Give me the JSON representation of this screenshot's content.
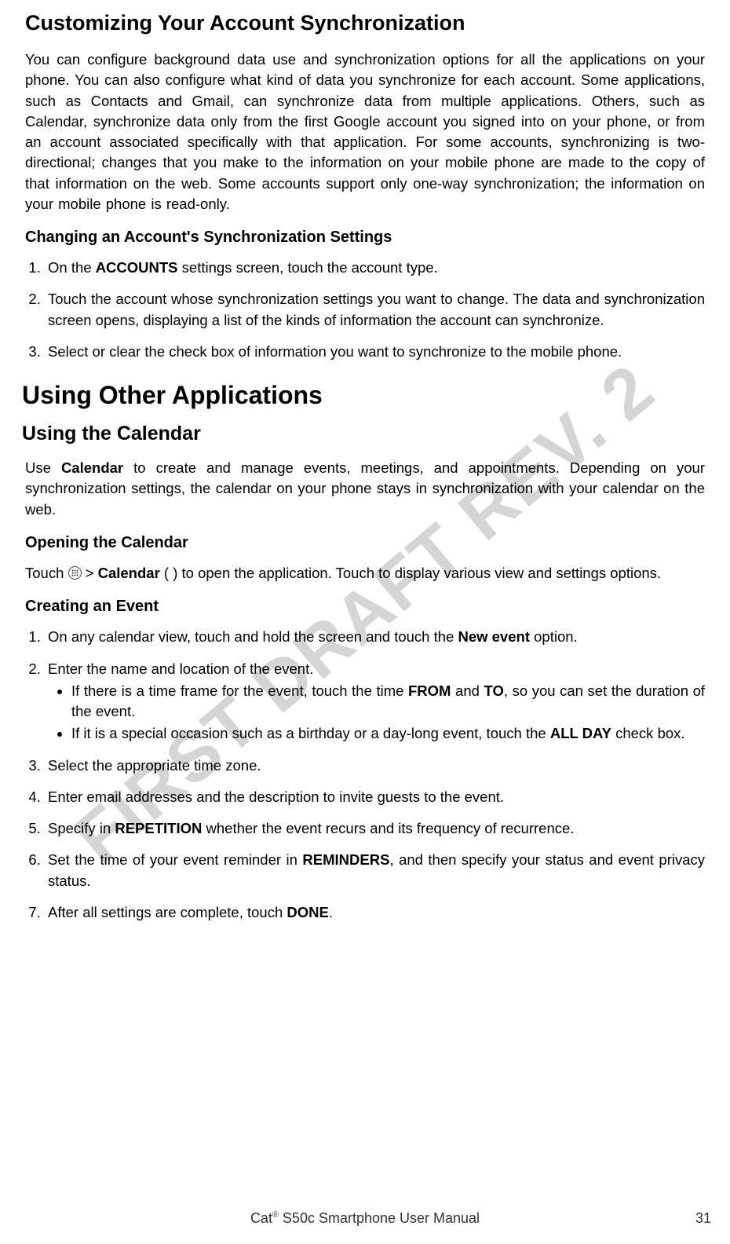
{
  "watermark": "FIRST DRAFT REV. 2",
  "h_custom": "Customizing Your Account Synchronization",
  "p_custom": "You can configure background data use and synchronization options for all the applications on your phone. You can also configure what kind of data you synchronize for each account. Some applications, such as Contacts and Gmail, can synchronize data from multiple applications. Others, such as Calendar, synchronize data only from the first Google account you signed into on your phone, or from an account associated specifically with that application. For some accounts, synchronizing is two-directional; changes that you make to the information on your mobile phone are made to the copy of that information on the web. Some accounts support only one-way synchronization; the information on your mobile phone is read-only.",
  "h_changing": "Changing an Account's Synchronization Settings",
  "chg1_pre": "On the ",
  "chg1_b": "ACCOUNTS",
  "chg1_post": " settings screen, touch the account type.",
  "chg2": "Touch the account whose synchronization settings you want to change. The data and synchronization screen opens, displaying a list of the kinds of information the account can synchronize.",
  "chg3": "Select or clear the check box of information you want to synchronize to the mobile phone.",
  "h_using_apps": "Using Other Applications",
  "h_using_cal": "Using the Calendar",
  "p_cal_pre": "Use ",
  "p_cal_b": "Calendar",
  "p_cal_post": " to create and manage events, meetings, and appointments. Depending on your synchronization settings, the calendar on your phone stays in synchronization with your calendar on the web.",
  "h_opening": "Opening the Calendar",
  "open_pre": "Touch ",
  "open_gt": " > ",
  "open_b": "Calendar",
  "open_post1": " (   ) to open the application. Touch     to display various view and settings options.",
  "h_creating": "Creating an Event",
  "ce1_pre": "On any calendar view, touch and hold the screen and touch the ",
  "ce1_b": "New event",
  "ce1_post": " option.",
  "ce2_main": "Enter the name and location of the event.",
  "ce2_b1_pre": "If there is a time frame for the event, touch the time ",
  "ce2_b1_from": "FROM",
  "ce2_b1_mid": " and ",
  "ce2_b1_to": "TO",
  "ce2_b1_post": ", so you can set the duration of the event.",
  "ce2_b2_pre": "If it is a special occasion such as a birthday or a day-long event, touch the ",
  "ce2_b2_b": "ALL DAY",
  "ce2_b2_post": " check box.",
  "ce3": "Select the appropriate time zone.",
  "ce4": "Enter email addresses and the description to invite guests to the event.",
  "ce5_pre": "Specify in ",
  "ce5_b": "REPETITION",
  "ce5_post": " whether the event recurs and its frequency of recurrence.",
  "ce6_pre": "Set the time of your event reminder in ",
  "ce6_b": "REMINDERS",
  "ce6_post": ", and then specify your status and event privacy status.",
  "ce7_pre": "After all settings are complete, touch ",
  "ce7_b": "DONE",
  "ce7_post": ".",
  "footer_brand_pre": "Cat",
  "footer_brand_sup": "®",
  "footer_brand_post": " S50c Smartphone User Manual",
  "page_no": "31"
}
